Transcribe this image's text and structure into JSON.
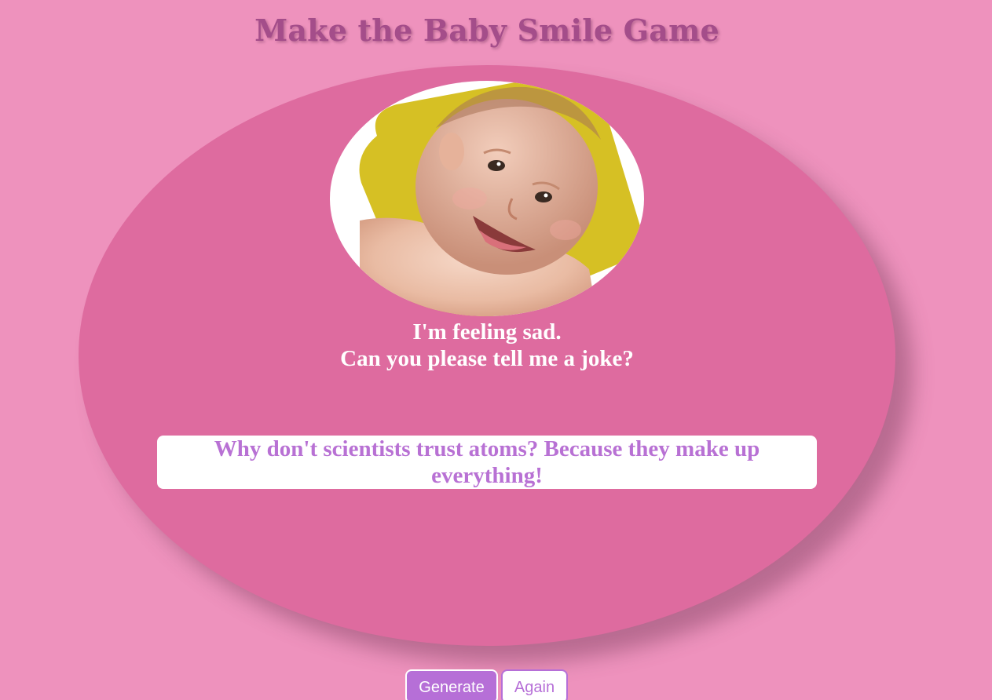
{
  "game": {
    "title": "Make the Baby Smile Game",
    "baby": {
      "image_alt": "smiling baby",
      "mood": "smiling"
    },
    "message": {
      "line1": "I'm feeling sad.",
      "line2": "Can you please tell me a joke?"
    },
    "joke": "Why don't scientists trust atoms? Because they make up everything!"
  },
  "buttons": {
    "generate_label": "Generate",
    "again_label": "Again"
  },
  "colors": {
    "background": "#ee92bd",
    "oval": "#de6b9f",
    "title": "#a44d8a",
    "accent": "#b66fd7",
    "photo_backdrop": "#d6c024"
  }
}
